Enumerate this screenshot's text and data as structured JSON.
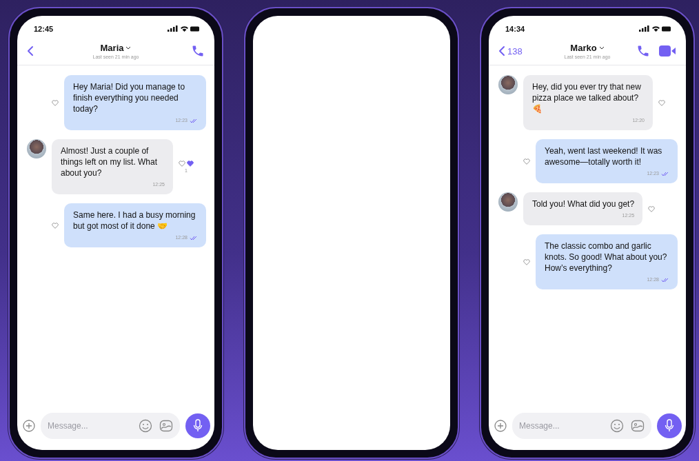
{
  "phones": [
    {
      "kind": "chat",
      "status_time": "12:45",
      "contact": "Maria",
      "last_seen": "Last seen 21 min ago",
      "video_call": false,
      "messages": [
        {
          "kind": "outgoing",
          "text": "Hey Maria! Did you manage to finish everything you needed today?",
          "time": "12:23",
          "read": true,
          "liked": false
        },
        {
          "kind": "incoming",
          "text": "Almost! Just a couple of things left on my list. What about you?",
          "time": "12:25",
          "liked": true,
          "like_count": "1"
        },
        {
          "kind": "outgoing",
          "text": "Same here. I had a busy morning but got most of it done 🤝",
          "time": "12:28",
          "read": true,
          "liked": false
        }
      ],
      "composer": {
        "placeholder": "Message..."
      }
    },
    {
      "kind": "blank"
    },
    {
      "kind": "chat",
      "status_time": "14:34",
      "back_count": "138",
      "contact": "Marko",
      "last_seen": "Last seen 21 min ago",
      "video_call": true,
      "messages": [
        {
          "kind": "incoming",
          "text": "Hey, did you ever try that new pizza place we talked about? 🍕",
          "time": "12:20",
          "liked": false
        },
        {
          "kind": "outgoing",
          "text": "Yeah, went last weekend! It was awesome—totally worth it!",
          "time": "12:23",
          "read": true,
          "liked": false
        },
        {
          "kind": "incoming",
          "text": "Told you! What did you get?",
          "time": "12:25",
          "liked": false
        },
        {
          "kind": "outgoing",
          "text": "The classic combo and garlic knots. So good! What about you? How’s everything?",
          "time": "12:28",
          "read": true,
          "liked": false
        }
      ],
      "composer": {
        "placeholder": "Message..."
      }
    }
  ]
}
